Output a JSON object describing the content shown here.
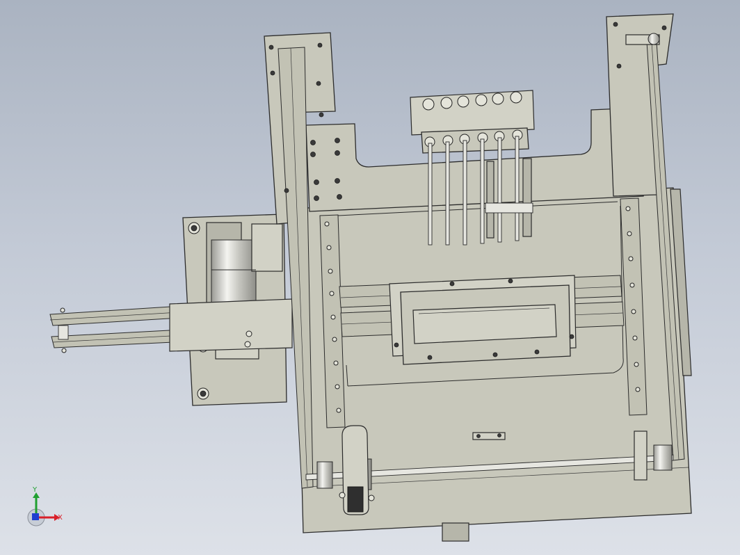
{
  "view": {
    "background_top": "#aab3c1",
    "background_bottom": "#dde1e8",
    "part_color": "#c8c8bb",
    "edge_color": "#2b2b2b"
  },
  "triad": {
    "x_label": "X",
    "y_label": "Y",
    "x_color": "#d9202a",
    "y_color": "#20a030",
    "z_color": "#2040d0"
  }
}
